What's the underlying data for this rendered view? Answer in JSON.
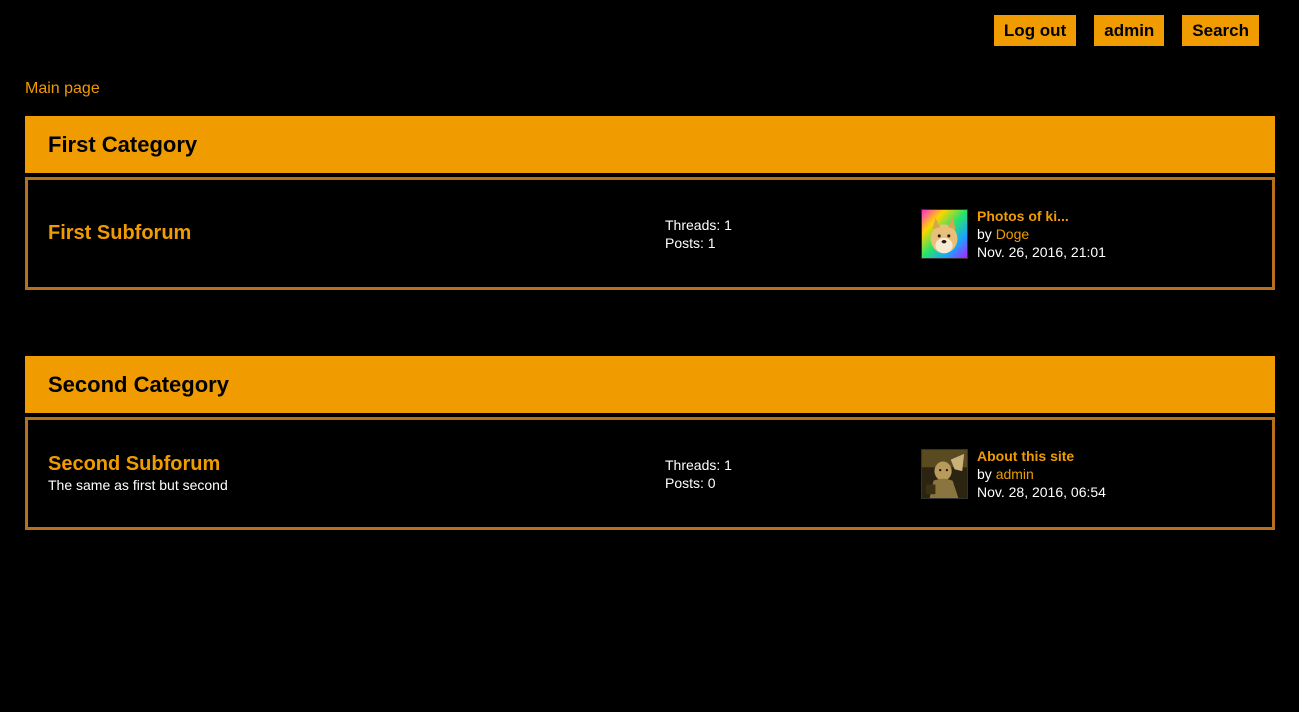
{
  "header": {
    "buttons": {
      "logout": "Log out",
      "profile": "admin",
      "search": "Search"
    }
  },
  "breadcrumb": {
    "main": "Main page"
  },
  "categories": [
    {
      "title": "First Category",
      "subforums": [
        {
          "title": "First Subforum",
          "description": "",
          "threads_label": "Threads: 1",
          "posts_label": "Posts: 1",
          "last_post": {
            "title": "Photos of ki...",
            "by_prefix": "by ",
            "author": "Doge",
            "date": "Nov. 26, 2016, 21:01",
            "avatar_icon": "doge-avatar"
          }
        }
      ]
    },
    {
      "title": "Second Category",
      "subforums": [
        {
          "title": "Second Subforum",
          "description": "The same as first but second",
          "threads_label": "Threads: 1",
          "posts_label": "Posts: 0",
          "last_post": {
            "title": "About this site",
            "by_prefix": "by ",
            "author": "admin",
            "date": "Nov. 28, 2016, 06:54",
            "avatar_icon": "admin-avatar"
          }
        }
      ]
    }
  ],
  "colors": {
    "accent": "#f09c00",
    "background": "#000000",
    "border": "#b8701e"
  }
}
